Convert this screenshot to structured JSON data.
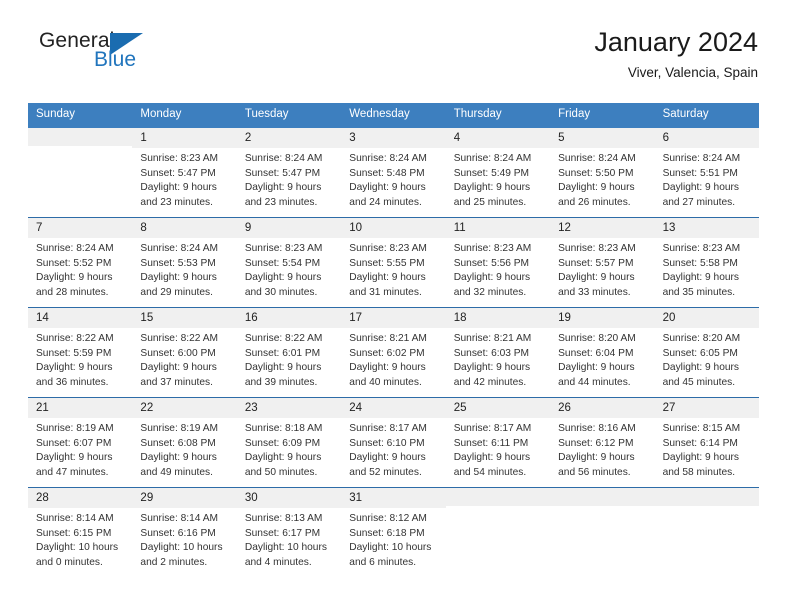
{
  "brand": {
    "name_part1": "General",
    "name_part2": "Blue",
    "logo_icon": "triangle-logo-icon"
  },
  "header": {
    "title": "January 2024",
    "location": "Viver, Valencia, Spain"
  },
  "weekdays": [
    "Sunday",
    "Monday",
    "Tuesday",
    "Wednesday",
    "Thursday",
    "Friday",
    "Saturday"
  ],
  "colors": {
    "header_blue": "#3d7fbf",
    "row_divider_blue": "#2d6ca8",
    "day_number_band": "#f0f0f0",
    "brand_blue": "#2175bd"
  },
  "weeks": [
    [
      {
        "day": "",
        "empty": true,
        "sunrise": "",
        "sunset": "",
        "daylight_line1": "",
        "daylight_line2": ""
      },
      {
        "day": "1",
        "sunrise": "Sunrise: 8:23 AM",
        "sunset": "Sunset: 5:47 PM",
        "daylight_line1": "Daylight: 9 hours",
        "daylight_line2": "and 23 minutes."
      },
      {
        "day": "2",
        "sunrise": "Sunrise: 8:24 AM",
        "sunset": "Sunset: 5:47 PM",
        "daylight_line1": "Daylight: 9 hours",
        "daylight_line2": "and 23 minutes."
      },
      {
        "day": "3",
        "sunrise": "Sunrise: 8:24 AM",
        "sunset": "Sunset: 5:48 PM",
        "daylight_line1": "Daylight: 9 hours",
        "daylight_line2": "and 24 minutes."
      },
      {
        "day": "4",
        "sunrise": "Sunrise: 8:24 AM",
        "sunset": "Sunset: 5:49 PM",
        "daylight_line1": "Daylight: 9 hours",
        "daylight_line2": "and 25 minutes."
      },
      {
        "day": "5",
        "sunrise": "Sunrise: 8:24 AM",
        "sunset": "Sunset: 5:50 PM",
        "daylight_line1": "Daylight: 9 hours",
        "daylight_line2": "and 26 minutes."
      },
      {
        "day": "6",
        "sunrise": "Sunrise: 8:24 AM",
        "sunset": "Sunset: 5:51 PM",
        "daylight_line1": "Daylight: 9 hours",
        "daylight_line2": "and 27 minutes."
      }
    ],
    [
      {
        "day": "7",
        "sunrise": "Sunrise: 8:24 AM",
        "sunset": "Sunset: 5:52 PM",
        "daylight_line1": "Daylight: 9 hours",
        "daylight_line2": "and 28 minutes."
      },
      {
        "day": "8",
        "sunrise": "Sunrise: 8:24 AM",
        "sunset": "Sunset: 5:53 PM",
        "daylight_line1": "Daylight: 9 hours",
        "daylight_line2": "and 29 minutes."
      },
      {
        "day": "9",
        "sunrise": "Sunrise: 8:23 AM",
        "sunset": "Sunset: 5:54 PM",
        "daylight_line1": "Daylight: 9 hours",
        "daylight_line2": "and 30 minutes."
      },
      {
        "day": "10",
        "sunrise": "Sunrise: 8:23 AM",
        "sunset": "Sunset: 5:55 PM",
        "daylight_line1": "Daylight: 9 hours",
        "daylight_line2": "and 31 minutes."
      },
      {
        "day": "11",
        "sunrise": "Sunrise: 8:23 AM",
        "sunset": "Sunset: 5:56 PM",
        "daylight_line1": "Daylight: 9 hours",
        "daylight_line2": "and 32 minutes."
      },
      {
        "day": "12",
        "sunrise": "Sunrise: 8:23 AM",
        "sunset": "Sunset: 5:57 PM",
        "daylight_line1": "Daylight: 9 hours",
        "daylight_line2": "and 33 minutes."
      },
      {
        "day": "13",
        "sunrise": "Sunrise: 8:23 AM",
        "sunset": "Sunset: 5:58 PM",
        "daylight_line1": "Daylight: 9 hours",
        "daylight_line2": "and 35 minutes."
      }
    ],
    [
      {
        "day": "14",
        "sunrise": "Sunrise: 8:22 AM",
        "sunset": "Sunset: 5:59 PM",
        "daylight_line1": "Daylight: 9 hours",
        "daylight_line2": "and 36 minutes."
      },
      {
        "day": "15",
        "sunrise": "Sunrise: 8:22 AM",
        "sunset": "Sunset: 6:00 PM",
        "daylight_line1": "Daylight: 9 hours",
        "daylight_line2": "and 37 minutes."
      },
      {
        "day": "16",
        "sunrise": "Sunrise: 8:22 AM",
        "sunset": "Sunset: 6:01 PM",
        "daylight_line1": "Daylight: 9 hours",
        "daylight_line2": "and 39 minutes."
      },
      {
        "day": "17",
        "sunrise": "Sunrise: 8:21 AM",
        "sunset": "Sunset: 6:02 PM",
        "daylight_line1": "Daylight: 9 hours",
        "daylight_line2": "and 40 minutes."
      },
      {
        "day": "18",
        "sunrise": "Sunrise: 8:21 AM",
        "sunset": "Sunset: 6:03 PM",
        "daylight_line1": "Daylight: 9 hours",
        "daylight_line2": "and 42 minutes."
      },
      {
        "day": "19",
        "sunrise": "Sunrise: 8:20 AM",
        "sunset": "Sunset: 6:04 PM",
        "daylight_line1": "Daylight: 9 hours",
        "daylight_line2": "and 44 minutes."
      },
      {
        "day": "20",
        "sunrise": "Sunrise: 8:20 AM",
        "sunset": "Sunset: 6:05 PM",
        "daylight_line1": "Daylight: 9 hours",
        "daylight_line2": "and 45 minutes."
      }
    ],
    [
      {
        "day": "21",
        "sunrise": "Sunrise: 8:19 AM",
        "sunset": "Sunset: 6:07 PM",
        "daylight_line1": "Daylight: 9 hours",
        "daylight_line2": "and 47 minutes."
      },
      {
        "day": "22",
        "sunrise": "Sunrise: 8:19 AM",
        "sunset": "Sunset: 6:08 PM",
        "daylight_line1": "Daylight: 9 hours",
        "daylight_line2": "and 49 minutes."
      },
      {
        "day": "23",
        "sunrise": "Sunrise: 8:18 AM",
        "sunset": "Sunset: 6:09 PM",
        "daylight_line1": "Daylight: 9 hours",
        "daylight_line2": "and 50 minutes."
      },
      {
        "day": "24",
        "sunrise": "Sunrise: 8:17 AM",
        "sunset": "Sunset: 6:10 PM",
        "daylight_line1": "Daylight: 9 hours",
        "daylight_line2": "and 52 minutes."
      },
      {
        "day": "25",
        "sunrise": "Sunrise: 8:17 AM",
        "sunset": "Sunset: 6:11 PM",
        "daylight_line1": "Daylight: 9 hours",
        "daylight_line2": "and 54 minutes."
      },
      {
        "day": "26",
        "sunrise": "Sunrise: 8:16 AM",
        "sunset": "Sunset: 6:12 PM",
        "daylight_line1": "Daylight: 9 hours",
        "daylight_line2": "and 56 minutes."
      },
      {
        "day": "27",
        "sunrise": "Sunrise: 8:15 AM",
        "sunset": "Sunset: 6:14 PM",
        "daylight_line1": "Daylight: 9 hours",
        "daylight_line2": "and 58 minutes."
      }
    ],
    [
      {
        "day": "28",
        "sunrise": "Sunrise: 8:14 AM",
        "sunset": "Sunset: 6:15 PM",
        "daylight_line1": "Daylight: 10 hours",
        "daylight_line2": "and 0 minutes."
      },
      {
        "day": "29",
        "sunrise": "Sunrise: 8:14 AM",
        "sunset": "Sunset: 6:16 PM",
        "daylight_line1": "Daylight: 10 hours",
        "daylight_line2": "and 2 minutes."
      },
      {
        "day": "30",
        "sunrise": "Sunrise: 8:13 AM",
        "sunset": "Sunset: 6:17 PM",
        "daylight_line1": "Daylight: 10 hours",
        "daylight_line2": "and 4 minutes."
      },
      {
        "day": "31",
        "sunrise": "Sunrise: 8:12 AM",
        "sunset": "Sunset: 6:18 PM",
        "daylight_line1": "Daylight: 10 hours",
        "daylight_line2": "and 6 minutes."
      },
      {
        "day": "",
        "empty": true,
        "sunrise": "",
        "sunset": "",
        "daylight_line1": "",
        "daylight_line2": ""
      },
      {
        "day": "",
        "empty": true,
        "sunrise": "",
        "sunset": "",
        "daylight_line1": "",
        "daylight_line2": ""
      },
      {
        "day": "",
        "empty": true,
        "sunrise": "",
        "sunset": "",
        "daylight_line1": "",
        "daylight_line2": ""
      }
    ]
  ]
}
